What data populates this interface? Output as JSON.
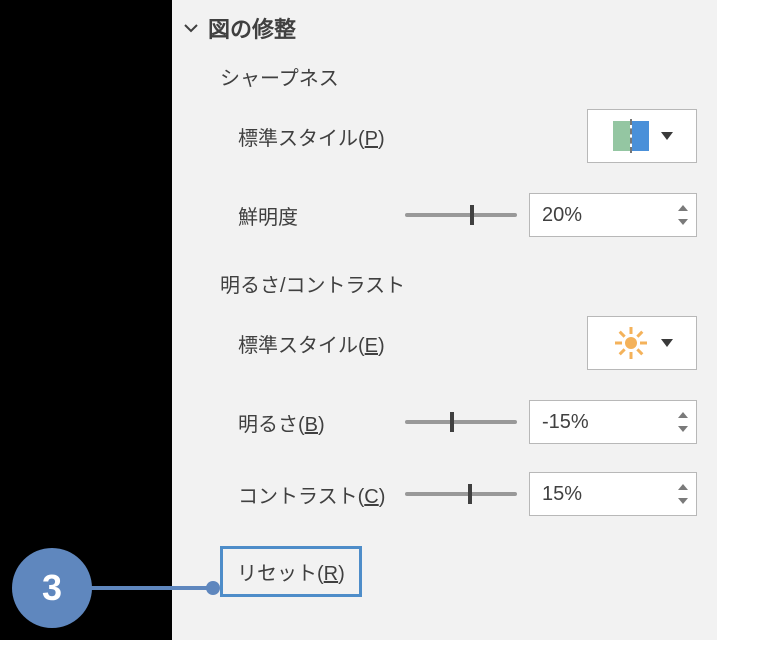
{
  "callout": {
    "number": "3"
  },
  "section": {
    "title": "図の修整"
  },
  "sharpness": {
    "header": "シャープネス",
    "preset_label_pre": "標準スタイル(",
    "preset_mnemonic": "P",
    "preset_label_post": ")",
    "sharpness_label": "鮮明度",
    "sharpness_value": "20%",
    "sharpness_slider_pct": 60
  },
  "brightness_contrast": {
    "header": "明るさ/コントラスト",
    "preset_label_pre": "標準スタイル(",
    "preset_mnemonic": "E",
    "preset_label_post": ")",
    "brightness_label_pre": "明るさ(",
    "brightness_mnemonic": "B",
    "brightness_label_post": ")",
    "brightness_value": "-15%",
    "brightness_slider_pct": 42,
    "contrast_label_pre": "コントラスト(",
    "contrast_mnemonic": "C",
    "contrast_label_post": ")",
    "contrast_value": "15%",
    "contrast_slider_pct": 58
  },
  "reset": {
    "label_pre": "リセット(",
    "mnemonic": "R",
    "label_post": ")"
  }
}
